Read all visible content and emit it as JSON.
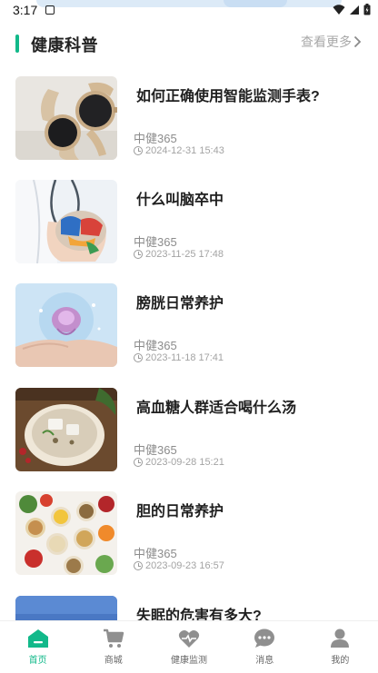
{
  "status_bar": {
    "time": "3:17"
  },
  "section": {
    "title": "健康科普",
    "more_label": "查看更多"
  },
  "articles": [
    {
      "title": "如何正确使用智能监测手表?",
      "source": "中健365",
      "date": "2024-12-31 15:43",
      "image": "smartwatches"
    },
    {
      "title": "什么叫脑卒中",
      "source": "中健365",
      "date": "2023-11-25 17:48",
      "image": "doctor-holding-brain-model"
    },
    {
      "title": "膀胱日常养护",
      "source": "中健365",
      "date": "2023-11-18 17:41",
      "image": "hands-holding-bladder-model"
    },
    {
      "title": "高血糖人群适合喝什么汤",
      "source": "中健365",
      "date": "2023-09-28 15:21",
      "image": "bowl-of-soup"
    },
    {
      "title": "胆的日常养护",
      "source": "中健365",
      "date": "2023-09-23 16:57",
      "image": "bowls-of-grains-and-vegetables"
    },
    {
      "title": "失眠的危害有多大?",
      "source": "",
      "date": "",
      "image": "blue-scene"
    }
  ],
  "nav": {
    "items": [
      {
        "label": "首页",
        "icon": "home-icon",
        "active": true
      },
      {
        "label": "商城",
        "icon": "cart-icon",
        "active": false
      },
      {
        "label": "健康监测",
        "icon": "heart-icon",
        "active": false
      },
      {
        "label": "消息",
        "icon": "message-icon",
        "active": false
      },
      {
        "label": "我的",
        "icon": "user-icon",
        "active": false
      }
    ]
  },
  "colors": {
    "accent": "#12b98a",
    "muted_text": "#a8a8a8",
    "title_text": "#1f1f1f"
  }
}
